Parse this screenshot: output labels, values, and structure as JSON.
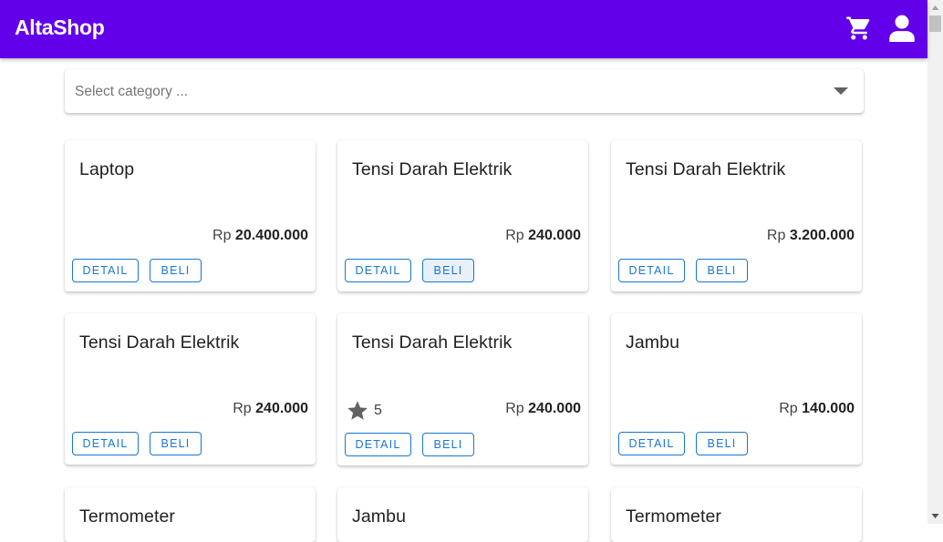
{
  "app": {
    "title": "AltaShop"
  },
  "header": {
    "cart_icon": "cart-icon",
    "user_icon": "account-icon"
  },
  "filter": {
    "placeholder": "Select category ..."
  },
  "buttons": {
    "detail": "DETAIL",
    "beli": "BELI"
  },
  "colors": {
    "appbar": "#6200ea",
    "button": "#1976d2"
  },
  "products": [
    {
      "name": "Laptop",
      "currency": "Rp",
      "price": "20.400.000"
    },
    {
      "name": "Tensi Darah Elektrik",
      "currency": "Rp",
      "price": "240.000"
    },
    {
      "name": "Tensi Darah Elektrik",
      "currency": "Rp",
      "price": "3.200.000"
    },
    {
      "name": "Tensi Darah Elektrik",
      "currency": "Rp",
      "price": "240.000"
    },
    {
      "name": "Tensi Darah Elektrik",
      "currency": "Rp",
      "price": "240.000",
      "rating": "5"
    },
    {
      "name": "Jambu",
      "currency": "Rp",
      "price": "140.000"
    },
    {
      "name": "Termometer"
    },
    {
      "name": "Jambu"
    },
    {
      "name": "Termometer"
    }
  ]
}
